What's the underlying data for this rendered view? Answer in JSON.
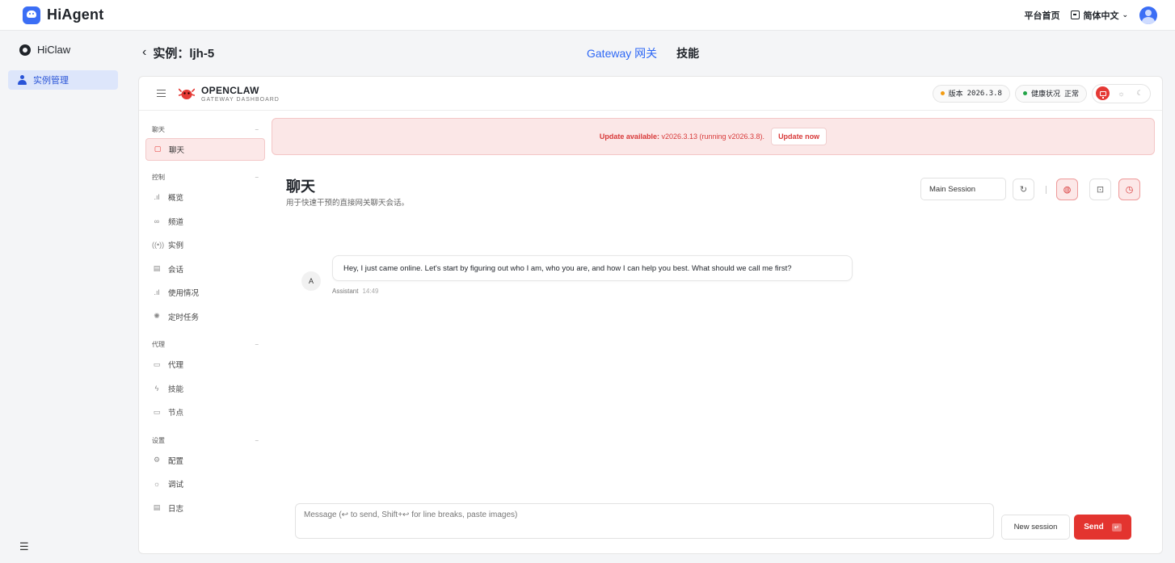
{
  "app": {
    "name": "HiAgent"
  },
  "topbar": {
    "home_link": "平台首页",
    "language": "简体中文"
  },
  "sidebar": {
    "brand": "HiClaw",
    "items": [
      {
        "label": "实例管理",
        "icon": "person-icon",
        "active": true
      }
    ]
  },
  "header": {
    "back_icon": "chevron-left-icon",
    "title": "实例：ljh-5",
    "tabs": [
      {
        "label": "Gateway 网关",
        "active": true
      },
      {
        "label": "技能",
        "active": false
      }
    ]
  },
  "openclaw": {
    "name": "OPENCLAW",
    "subtitle": "GATEWAY DASHBOARD",
    "version_label": "版本",
    "version_value": "2026.3.8",
    "health_label": "健康状况",
    "health_value": "正常",
    "nav": [
      {
        "group": "聊天",
        "items": [
          {
            "label": "聊天",
            "icon": "chat-icon",
            "active": true
          }
        ]
      },
      {
        "group": "控制",
        "items": [
          {
            "label": "概览",
            "icon": "bar-chart-icon"
          },
          {
            "label": "频道",
            "icon": "link-icon"
          },
          {
            "label": "实例",
            "icon": "broadcast-icon"
          },
          {
            "label": "会话",
            "icon": "document-icon"
          },
          {
            "label": "使用情况",
            "icon": "bar-chart-icon"
          },
          {
            "label": "定时任务",
            "icon": "loader-icon"
          }
        ]
      },
      {
        "group": "代理",
        "items": [
          {
            "label": "代理",
            "icon": "folder-icon"
          },
          {
            "label": "技能",
            "icon": "zap-icon"
          },
          {
            "label": "节点",
            "icon": "monitor-icon"
          }
        ]
      },
      {
        "group": "设置",
        "items": [
          {
            "label": "配置",
            "icon": "gear-icon"
          },
          {
            "label": "调试",
            "icon": "bug-icon"
          },
          {
            "label": "日志",
            "icon": "log-icon"
          }
        ]
      }
    ],
    "banner": {
      "lead": "Update available:",
      "text": "v2026.3.13 (running v2026.3.8).",
      "button": "Update now"
    },
    "chat": {
      "title": "聊天",
      "subtitle": "用于快速干预的直接网关聊天会话。",
      "session": "Main Session",
      "message": {
        "avatar": "A",
        "text": "Hey, I just came online. Let's start by figuring out who I am, who you are, and how I can help you best. What should we call me first?",
        "author": "Assistant",
        "time": "14:49"
      },
      "composer_placeholder": "Message (↩ to send, Shift+↩ for line breaks, paste images)",
      "new_session": "New session",
      "send": "Send"
    }
  },
  "colors": {
    "brand_blue": "#3b6ef5",
    "accent_red": "#e3342f",
    "status_ok": "#22a447",
    "version_dot": "#f39c12"
  }
}
